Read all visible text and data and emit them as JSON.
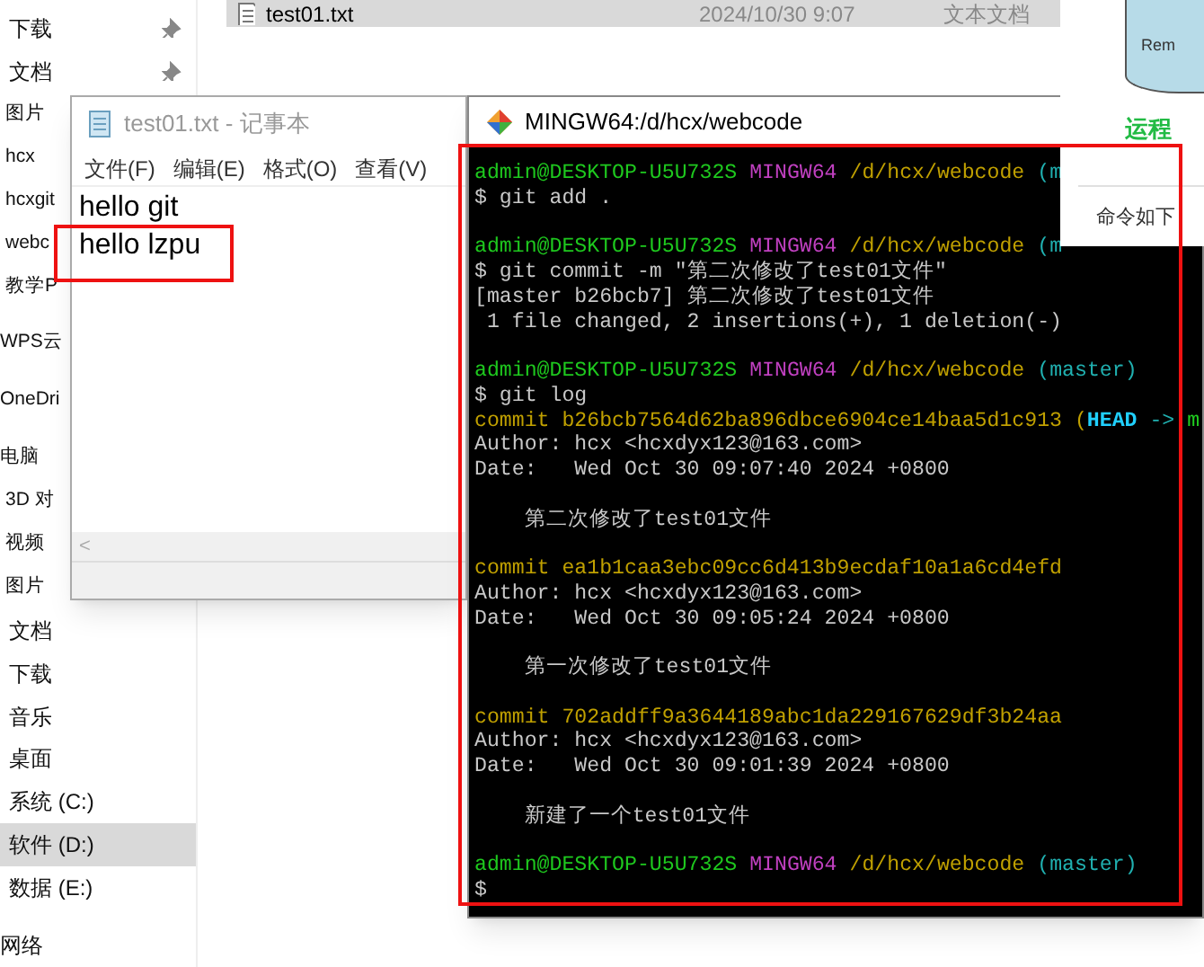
{
  "explorer": {
    "file_rows": [
      {
        "name": "test01.txt",
        "modified": "2024/10/30 9:07",
        "type": "文本文档",
        "selected": true
      }
    ],
    "sidebar": {
      "items": [
        {
          "children": [
            {
              "label": "下载",
              "pinned": true,
              "selected": false
            },
            {
              "label": "文档",
              "pinned": true,
              "selected": false
            },
            {
              "label": "图片",
              "pinned": false,
              "selected": false
            },
            {
              "label": "hcx",
              "pinned": false,
              "selected": false
            },
            {
              "label": "hcxgit",
              "pinned": false,
              "selected": false
            },
            {
              "label": "webc",
              "pinned": false,
              "selected": false
            },
            {
              "label": "教学P",
              "pinned": false,
              "selected": false
            }
          ]
        },
        {
          "label": "WPS云",
          "selected": false
        },
        {
          "label": "OneDri",
          "selected": false
        },
        {
          "label": "电脑",
          "selected": false,
          "children": [
            {
              "label": "3D 对",
              "selected": false
            },
            {
              "label": "视频",
              "selected": false
            },
            {
              "label": "图片",
              "selected": false
            },
            {
              "label": "文档",
              "selected": false
            },
            {
              "label": "下载",
              "selected": false
            },
            {
              "label": "音乐",
              "selected": false
            },
            {
              "label": "桌面",
              "selected": false
            },
            {
              "label": "系统 (C:)",
              "selected": false
            },
            {
              "label": "软件 (D:)",
              "selected": true
            },
            {
              "label": "数据 (E:)",
              "selected": false
            }
          ]
        },
        {
          "label": "网络",
          "selected": false
        }
      ]
    }
  },
  "document_panel": {
    "diagram_label": "Rem",
    "heading": "运程",
    "text": "命令如下"
  },
  "notepad": {
    "title": "test01.txt - 记事本",
    "menu": [
      "文件(F)",
      "编辑(E)",
      "格式(O)",
      "查看(V)"
    ],
    "lines": [
      "hello git",
      "hello lzpu"
    ],
    "scroll_arrow": "<"
  },
  "terminal": {
    "title": "MINGW64:/d/hcx/webcode",
    "blocks": [
      [
        [
          {
            "text": "admin@DESKTOP-U5U732S",
            "kind": "user"
          },
          {
            "text": " MINGW64",
            "kind": "host"
          },
          {
            "text": " /d/hcx/webcode",
            "kind": "path"
          },
          {
            "text": " (m",
            "kind": "branch"
          }
        ],
        [
          {
            "text": "$ git add .",
            "kind": "text"
          }
        ]
      ],
      [
        [
          {
            "text": "admin@DESKTOP-U5U732S",
            "kind": "user"
          },
          {
            "text": " MINGW64",
            "kind": "host"
          },
          {
            "text": " /d/hcx/webcode",
            "kind": "path"
          },
          {
            "text": " (m",
            "kind": "branch"
          }
        ],
        [
          {
            "text": "$ git commit -m \"第二次修改了test01文件\"",
            "kind": "text"
          }
        ],
        [
          {
            "text": "[master b26bcb7] 第二次修改了test01文件",
            "kind": "text"
          }
        ],
        [
          {
            "text": " 1 file changed, 2 insertions(+), 1 deletion(-)",
            "kind": "text"
          }
        ]
      ],
      [
        [
          {
            "text": "admin@DESKTOP-U5U732S",
            "kind": "user"
          },
          {
            "text": " MINGW64",
            "kind": "host"
          },
          {
            "text": " /d/hcx/webcode",
            "kind": "path"
          },
          {
            "text": " (master)",
            "kind": "branch"
          }
        ],
        [
          {
            "text": "$ git log",
            "kind": "text"
          }
        ],
        [
          {
            "text": "commit b26bcb7564d62ba896dbce6904ce14baa5d1c913 (",
            "kind": "hash"
          },
          {
            "text": "HEAD",
            "kind": "head"
          },
          {
            "text": " -> ",
            "kind": "branch"
          },
          {
            "text": "m",
            "kind": "ref"
          }
        ],
        [
          {
            "text": "Author: hcx <hcxdyx123@163.com>",
            "kind": "text"
          }
        ],
        [
          {
            "text": "Date:   Wed Oct 30 09:07:40 2024 +0800",
            "kind": "text"
          }
        ]
      ],
      [
        [
          {
            "text": "    第二次修改了test01文件",
            "kind": "text"
          }
        ]
      ],
      [
        [
          {
            "text": "commit ea1b1caa3ebc09cc6d413b9ecdaf10a1a6cd4efd",
            "kind": "hash"
          }
        ],
        [
          {
            "text": "Author: hcx <hcxdyx123@163.com>",
            "kind": "text"
          }
        ],
        [
          {
            "text": "Date:   Wed Oct 30 09:05:24 2024 +0800",
            "kind": "text"
          }
        ]
      ],
      [
        [
          {
            "text": "    第一次修改了test01文件",
            "kind": "text"
          }
        ]
      ],
      [
        [
          {
            "text": "commit 702addff9a3644189abc1da229167629df3b24aa",
            "kind": "hash"
          }
        ],
        [
          {
            "text": "Author: hcx <hcxdyx123@163.com>",
            "kind": "text"
          }
        ],
        [
          {
            "text": "Date:   Wed Oct 30 09:01:39 2024 +0800",
            "kind": "text"
          }
        ]
      ],
      [
        [
          {
            "text": "    新建了一个test01文件",
            "kind": "text"
          }
        ]
      ],
      [
        [
          {
            "text": "admin@DESKTOP-U5U732S",
            "kind": "user"
          },
          {
            "text": " MINGW64",
            "kind": "host"
          },
          {
            "text": " /d/hcx/webcode",
            "kind": "path"
          },
          {
            "text": " (master)",
            "kind": "branch"
          }
        ],
        [
          {
            "text": "$",
            "kind": "text"
          }
        ]
      ]
    ]
  }
}
